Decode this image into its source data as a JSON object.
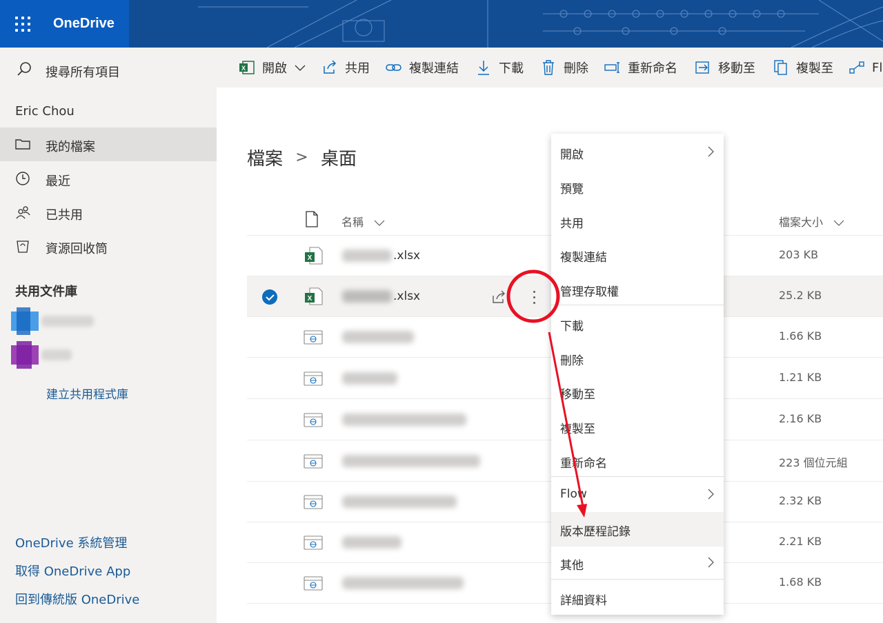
{
  "header": {
    "app_name": "OneDrive"
  },
  "sidebar": {
    "search_label": "搜尋所有項目",
    "user_name": "Eric Chou",
    "nav": [
      {
        "label": "我的檔案",
        "icon": "folder-icon"
      },
      {
        "label": "最近",
        "icon": "history-icon"
      },
      {
        "label": "已共用",
        "icon": "people-icon"
      },
      {
        "label": "資源回收筒",
        "icon": "recycle-bin-icon"
      }
    ],
    "shared_libraries_title": "共用文件庫",
    "create_library": "建立共用程式庫",
    "footer_links": [
      "OneDrive 系統管理",
      "取得 OneDrive App",
      "回到傳統版 OneDrive"
    ]
  },
  "toolbar": {
    "items": [
      {
        "label": "開啟",
        "icon": "excel-icon"
      },
      {
        "label": "共用",
        "icon": "share-icon"
      },
      {
        "label": "複製連結",
        "icon": "link-icon"
      },
      {
        "label": "下載",
        "icon": "download-icon"
      },
      {
        "label": "刪除",
        "icon": "delete-icon"
      },
      {
        "label": "重新命名",
        "icon": "rename-icon"
      },
      {
        "label": "移動至",
        "icon": "move-icon"
      },
      {
        "label": "複製至",
        "icon": "copy-icon"
      },
      {
        "label": "Fl",
        "icon": "flow-icon"
      }
    ]
  },
  "breadcrumb": {
    "root": "檔案",
    "separator": ">",
    "current": "桌面"
  },
  "columns": {
    "name": "名稱",
    "size": "檔案大小"
  },
  "files": [
    {
      "ext": ".xlsx",
      "size": "203 KB",
      "type": "excel"
    },
    {
      "ext": ".xlsx",
      "size": "25.2 KB",
      "type": "excel",
      "selected": true
    },
    {
      "ext": "",
      "size": "1.66 KB",
      "type": "web"
    },
    {
      "ext": "",
      "size": "1.21 KB",
      "type": "web"
    },
    {
      "ext": "",
      "size": "2.16 KB",
      "type": "web"
    },
    {
      "ext": "",
      "size": "223 個位元組",
      "type": "web"
    },
    {
      "ext": "",
      "size": "2.32 KB",
      "type": "web"
    },
    {
      "ext": "",
      "size": "2.21 KB",
      "type": "web"
    },
    {
      "ext": "",
      "size": "1.68 KB",
      "type": "web"
    }
  ],
  "context_menu": {
    "items": [
      {
        "label": "開啟",
        "submenu": true
      },
      {
        "label": "預覽"
      },
      {
        "label": "共用"
      },
      {
        "label": "複製連結"
      },
      {
        "label": "管理存取權"
      },
      {
        "label": "下載"
      },
      {
        "label": "刪除"
      },
      {
        "label": "移動至"
      },
      {
        "label": "複製至"
      },
      {
        "label": "重新命名"
      },
      {
        "label": "Flow",
        "submenu": true
      },
      {
        "label": "版本歷程記錄",
        "highlighted": true
      },
      {
        "label": "其他",
        "submenu": true
      },
      {
        "label": "詳細資料"
      }
    ]
  },
  "colors": {
    "header_bg": "#0f4c9a",
    "brand_block": "#0b5cbf",
    "accent": "#0f6cbd",
    "annotation": "#e81123"
  }
}
